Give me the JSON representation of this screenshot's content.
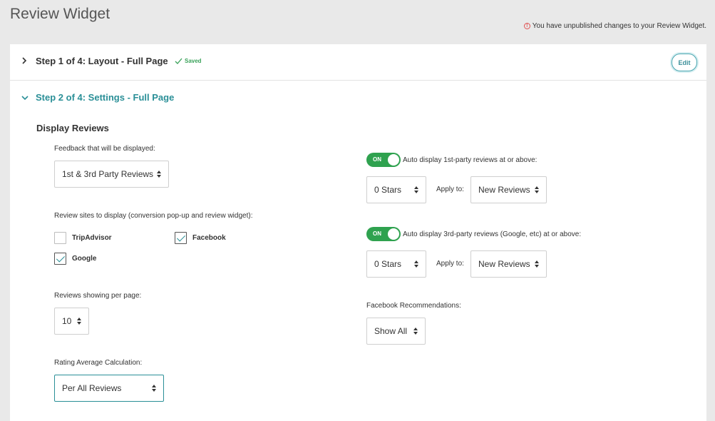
{
  "page": {
    "title": "Review Widget",
    "unpublished_notice": "You have unpublished changes to your Review Widget."
  },
  "step1": {
    "title": "Step 1 of 4: Layout - Full Page",
    "saved_label": "Saved",
    "edit_label": "Edit"
  },
  "step2": {
    "title": "Step 2 of 4: Settings - Full Page",
    "section_title": "Display Reviews",
    "feedback": {
      "label": "Feedback that will be displayed:",
      "value": "1st & 3rd Party Reviews"
    },
    "review_sites": {
      "label": "Review sites to display (conversion pop-up and review widget):",
      "options": [
        {
          "label": "TripAdvisor",
          "checked": false
        },
        {
          "label": "Facebook",
          "checked": true
        },
        {
          "label": "Google",
          "checked": true
        }
      ]
    },
    "per_page": {
      "label": "Reviews showing per page:",
      "value": "10"
    },
    "rating_avg": {
      "label": "Rating Average Calculation:",
      "value": "Per All Reviews"
    },
    "first_party": {
      "toggle": "ON",
      "label": "Auto display 1st-party reviews at or above:",
      "stars": "0 Stars",
      "apply_label": "Apply to:",
      "apply_value": "New Reviews"
    },
    "third_party": {
      "toggle": "ON",
      "label": "Auto display 3rd-party reviews (Google, etc) at or above:",
      "stars": "0 Stars",
      "apply_label": "Apply to:",
      "apply_value": "New Reviews"
    },
    "fb_recs": {
      "label": "Facebook Recommendations:",
      "value": "Show All"
    }
  },
  "colors": {
    "accent": "#2a8f97",
    "toggle_on": "#2fa24f",
    "saved": "#3aa25a",
    "warning": "#e05050"
  }
}
